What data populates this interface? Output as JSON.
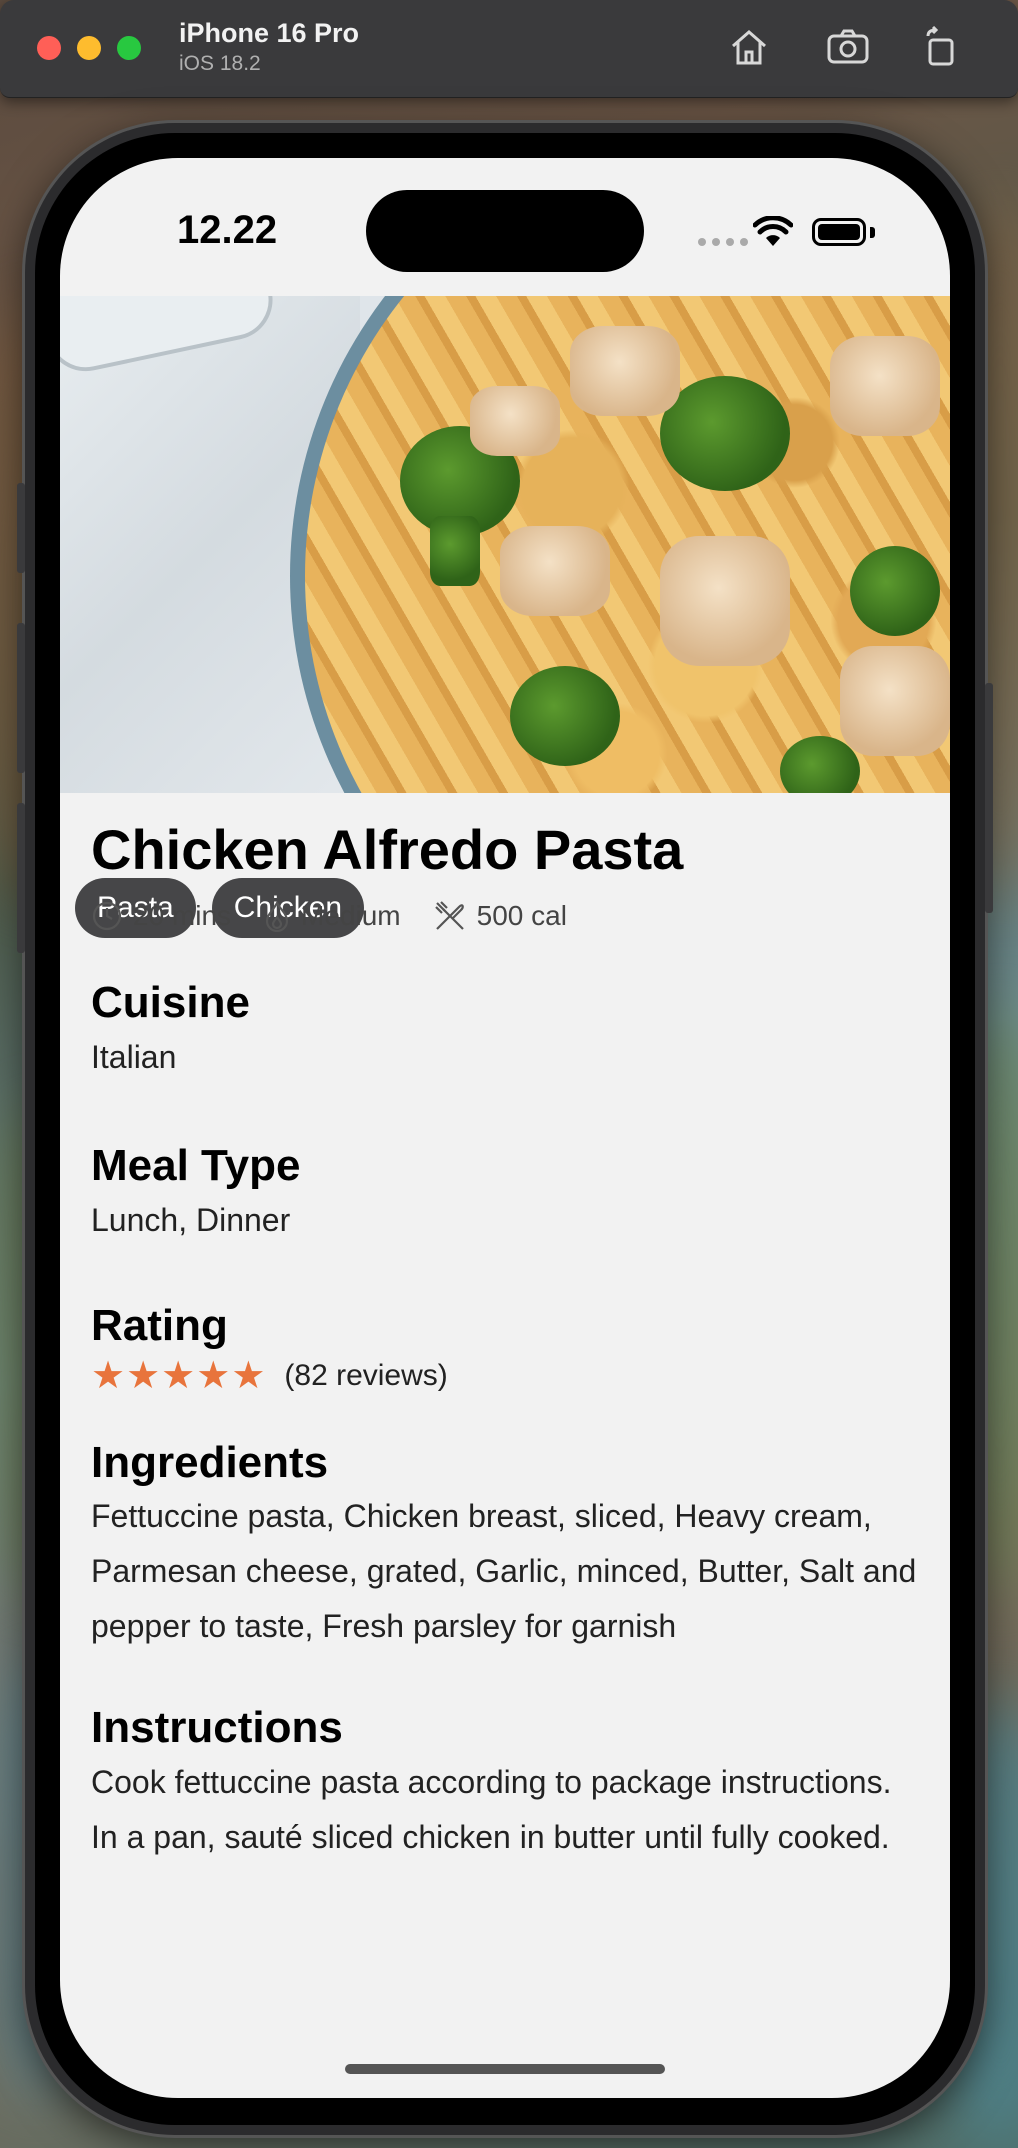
{
  "simulator": {
    "device_name": "iPhone 16 Pro",
    "os_version": "iOS 18.2",
    "toolbar_icons": [
      "home-icon",
      "screenshot-icon",
      "rotate-icon"
    ]
  },
  "status_bar": {
    "time": "12.22"
  },
  "recipe": {
    "tags": [
      "Pasta",
      "Chicken"
    ],
    "title": "Chicken Alfredo Pasta",
    "meta": {
      "time": "20 mins",
      "difficulty": "Medium",
      "calories": "500 cal"
    },
    "cuisine_label": "Cuisine",
    "cuisine": "Italian",
    "meal_type_label": "Meal Type",
    "meal_type": "Lunch, Dinner",
    "rating_label": "Rating",
    "rating": 5,
    "reviews": "(82 reviews)",
    "ingredients_label": "Ingredients",
    "ingredients": "Fettuccine pasta, Chicken breast, sliced, Heavy cream, Parmesan cheese, grated, Garlic, minced, Butter, Salt and pepper to taste, Fresh parsley for garnish",
    "instructions_label": "Instructions",
    "instructions": [
      "Cook fettuccine pasta according to package instructions.",
      "In a pan, sauté sliced chicken in butter until fully cooked."
    ]
  },
  "colors": {
    "star": "#e8743c",
    "screen_bg": "#f2f2f2",
    "tag_bg": "#28282a"
  }
}
